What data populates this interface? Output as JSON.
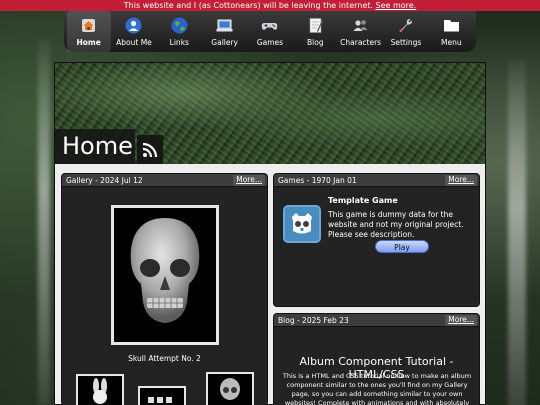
{
  "banner": {
    "text": "This website and I (as Cottonears) will be leaving the internet.",
    "link": "See more."
  },
  "nav": [
    {
      "label": "Home",
      "icon": "home-icon"
    },
    {
      "label": "About Me",
      "icon": "person-icon"
    },
    {
      "label": "Links",
      "icon": "globe-icon"
    },
    {
      "label": "Gallery",
      "icon": "laptop-icon"
    },
    {
      "label": "Games",
      "icon": "gamepad-icon"
    },
    {
      "label": "Blog",
      "icon": "notepad-icon"
    },
    {
      "label": "Characters",
      "icon": "users-icon"
    },
    {
      "label": "Settings",
      "icon": "wrench-icon"
    },
    {
      "label": "Menu",
      "icon": "folder-icon"
    }
  ],
  "page": {
    "title": "Home"
  },
  "gallery": {
    "header": "Gallery - 2024 Jul 12",
    "more": "More...",
    "caption": "Skull Attempt No. 2"
  },
  "games": {
    "header": "Games - 1970 Jan 01",
    "more": "More...",
    "title": "Template Game",
    "description": "This game is dummy data for the website and not my original project. Please see description.",
    "play": "Play"
  },
  "blog": {
    "header": "Blog - 2025 Feb 23",
    "more": "More...",
    "title": "Album Component Tutorial - HTML/CSS",
    "excerpt": "This is a HTML and CSS tutorial on how to make an album component similar to the ones you'll find on my Gallery page, so you can add something similar to your own websites! Complete with animations and with absolutely no JavaScript at all."
  },
  "colors": {
    "banner": "#c21e35",
    "play_button": "#7f9ef2",
    "godot_blue": "#478cbf"
  }
}
